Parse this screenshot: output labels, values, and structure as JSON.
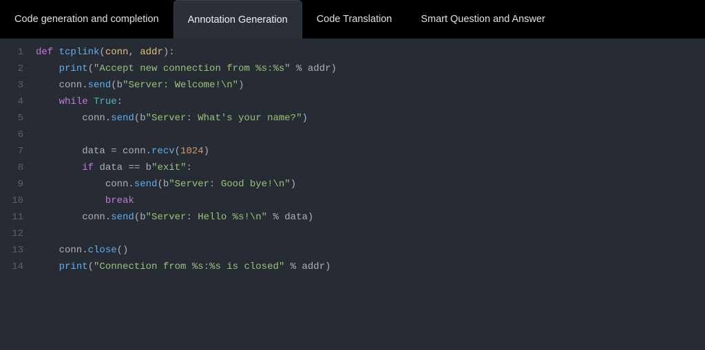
{
  "tabs": {
    "items": [
      {
        "label": "Code generation and completion",
        "active": false
      },
      {
        "label": "Annotation Generation",
        "active": true
      },
      {
        "label": "Code Translation",
        "active": false
      },
      {
        "label": "Smart Question and Answer",
        "active": false
      }
    ]
  },
  "code": {
    "lines": [
      {
        "n": "1",
        "tokens": [
          {
            "t": "def ",
            "c": "kw"
          },
          {
            "t": "tcplink",
            "c": "fn"
          },
          {
            "t": "(",
            "c": "id"
          },
          {
            "t": "conn",
            "c": "param"
          },
          {
            "t": ", ",
            "c": "id"
          },
          {
            "t": "addr",
            "c": "param"
          },
          {
            "t": "):",
            "c": "id"
          }
        ]
      },
      {
        "n": "2",
        "tokens": [
          {
            "t": "    ",
            "c": "id"
          },
          {
            "t": "print",
            "c": "fn"
          },
          {
            "t": "(",
            "c": "id"
          },
          {
            "t": "\"Accept new connection from %s:%s\"",
            "c": "str"
          },
          {
            "t": " % addr)",
            "c": "id"
          }
        ]
      },
      {
        "n": "3",
        "tokens": [
          {
            "t": "    conn.",
            "c": "id"
          },
          {
            "t": "send",
            "c": "fn"
          },
          {
            "t": "(",
            "c": "id"
          },
          {
            "t": "b",
            "c": "id"
          },
          {
            "t": "\"Server: Welcome!\\n\"",
            "c": "str"
          },
          {
            "t": ")",
            "c": "id"
          }
        ]
      },
      {
        "n": "4",
        "tokens": [
          {
            "t": "    ",
            "c": "id"
          },
          {
            "t": "while ",
            "c": "kw"
          },
          {
            "t": "True",
            "c": "bool"
          },
          {
            "t": ":",
            "c": "id"
          }
        ]
      },
      {
        "n": "5",
        "tokens": [
          {
            "t": "        conn.",
            "c": "id"
          },
          {
            "t": "send",
            "c": "fn"
          },
          {
            "t": "(",
            "c": "id"
          },
          {
            "t": "b",
            "c": "id"
          },
          {
            "t": "\"Server: What's your name?\"",
            "c": "str"
          },
          {
            "t": ")",
            "c": "id"
          }
        ]
      },
      {
        "n": "6",
        "tokens": [
          {
            "t": "",
            "c": "id"
          }
        ]
      },
      {
        "n": "7",
        "tokens": [
          {
            "t": "        data = conn.",
            "c": "id"
          },
          {
            "t": "recv",
            "c": "fn"
          },
          {
            "t": "(",
            "c": "id"
          },
          {
            "t": "1024",
            "c": "num"
          },
          {
            "t": ")",
            "c": "id"
          }
        ]
      },
      {
        "n": "8",
        "tokens": [
          {
            "t": "        ",
            "c": "id"
          },
          {
            "t": "if ",
            "c": "kw"
          },
          {
            "t": "data == ",
            "c": "id"
          },
          {
            "t": "b",
            "c": "id"
          },
          {
            "t": "\"exit\"",
            "c": "str"
          },
          {
            "t": ":",
            "c": "id"
          }
        ]
      },
      {
        "n": "9",
        "tokens": [
          {
            "t": "            conn.",
            "c": "id"
          },
          {
            "t": "send",
            "c": "fn"
          },
          {
            "t": "(",
            "c": "id"
          },
          {
            "t": "b",
            "c": "id"
          },
          {
            "t": "\"Server: Good bye!\\n\"",
            "c": "str"
          },
          {
            "t": ")",
            "c": "id"
          }
        ]
      },
      {
        "n": "10",
        "tokens": [
          {
            "t": "            ",
            "c": "id"
          },
          {
            "t": "break",
            "c": "kw"
          }
        ]
      },
      {
        "n": "11",
        "tokens": [
          {
            "t": "        conn.",
            "c": "id"
          },
          {
            "t": "send",
            "c": "fn"
          },
          {
            "t": "(",
            "c": "id"
          },
          {
            "t": "b",
            "c": "id"
          },
          {
            "t": "\"Server: Hello %s!\\n\"",
            "c": "str"
          },
          {
            "t": " % data)",
            "c": "id"
          }
        ]
      },
      {
        "n": "12",
        "tokens": [
          {
            "t": "",
            "c": "id"
          }
        ]
      },
      {
        "n": "13",
        "tokens": [
          {
            "t": "    conn.",
            "c": "id"
          },
          {
            "t": "close",
            "c": "fn"
          },
          {
            "t": "()",
            "c": "id"
          }
        ]
      },
      {
        "n": "14",
        "tokens": [
          {
            "t": "    ",
            "c": "id"
          },
          {
            "t": "print",
            "c": "fn"
          },
          {
            "t": "(",
            "c": "id"
          },
          {
            "t": "\"Connection from %s:%s is closed\"",
            "c": "str"
          },
          {
            "t": " % addr)",
            "c": "id"
          }
        ]
      }
    ]
  }
}
